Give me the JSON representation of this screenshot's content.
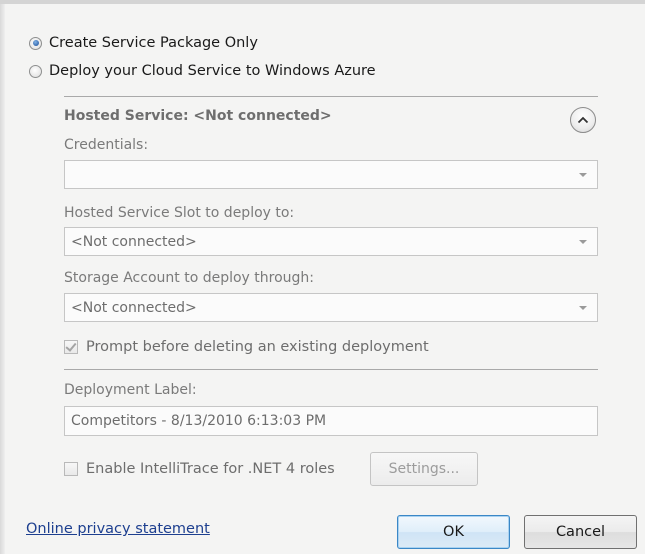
{
  "deploy_options": {
    "create_package_label": "Create Service Package Only",
    "deploy_label": "Deploy your Cloud Service to Windows Azure",
    "selected": "create_package"
  },
  "hosted_service": {
    "title": "Hosted Service: <Not connected>",
    "collapse_icon": "chevron-up-icon",
    "credentials_label": "Credentials:",
    "credentials_value": "",
    "slot_label": "Hosted Service Slot to deploy to:",
    "slot_value": "<Not connected>",
    "storage_label": "Storage Account to deploy through:",
    "storage_value": "<Not connected>",
    "prompt_label": "Prompt before deleting an existing deployment",
    "prompt_checked": true
  },
  "deployment": {
    "label_caption": "Deployment Label:",
    "label_value": "Competitors - 8/13/2010 6:13:03 PM"
  },
  "intellitrace": {
    "label": "Enable IntelliTrace for .NET 4 roles",
    "checked": false,
    "settings_label": "Settings..."
  },
  "footer": {
    "privacy_link": "Online privacy statement",
    "ok_label": "OK",
    "cancel_label": "Cancel"
  },
  "colors": {
    "link": "#1d3f8f",
    "ok_border": "#3b87c6",
    "disabled_text": "#6d6d6d"
  }
}
